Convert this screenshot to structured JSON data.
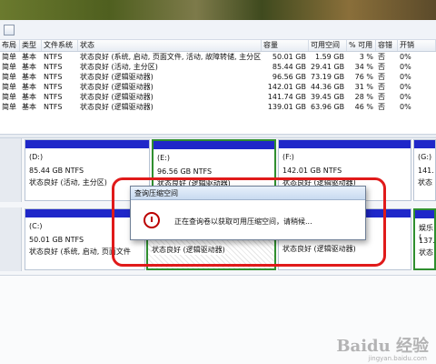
{
  "columns": [
    "布局",
    "类型",
    "文件系统",
    "状态",
    "容量",
    "可用空间",
    "% 可用",
    "容错",
    "开销"
  ],
  "volumes": [
    {
      "layout": "简单",
      "type": "基本",
      "fs": "NTFS",
      "status": "状态良好 (系统, 启动, 页面文件, 活动, 故障转储, 主分区)",
      "capacity": "50.01 GB",
      "free": "1.59 GB",
      "pct": "3 %",
      "fault": "否",
      "overhead": "0%"
    },
    {
      "layout": "简单",
      "type": "基本",
      "fs": "NTFS",
      "status": "状态良好 (活动, 主分区)",
      "capacity": "85.44 GB",
      "free": "29.41 GB",
      "pct": "34 %",
      "fault": "否",
      "overhead": "0%"
    },
    {
      "layout": "简单",
      "type": "基本",
      "fs": "NTFS",
      "status": "状态良好 (逻辑驱动器)",
      "capacity": "96.56 GB",
      "free": "73.19 GB",
      "pct": "76 %",
      "fault": "否",
      "overhead": "0%"
    },
    {
      "layout": "简单",
      "type": "基本",
      "fs": "NTFS",
      "status": "状态良好 (逻辑驱动器)",
      "capacity": "142.01 GB",
      "free": "44.36 GB",
      "pct": "31 %",
      "fault": "否",
      "overhead": "0%"
    },
    {
      "layout": "简单",
      "type": "基本",
      "fs": "NTFS",
      "status": "状态良好 (逻辑驱动器)",
      "capacity": "141.74 GB",
      "free": "39.45 GB",
      "pct": "28 %",
      "fault": "否",
      "overhead": "0%"
    },
    {
      "layout": "简单",
      "type": "基本",
      "fs": "NTFS",
      "status": "状态良好 (逻辑驱动器)",
      "capacity": "139.01 GB",
      "free": "63.96 GB",
      "pct": "46 %",
      "fault": "否",
      "overhead": "0%"
    }
  ],
  "disk0": {
    "d": {
      "name": "(D:)",
      "size": "85.44 GB NTFS",
      "status": "状态良好 (活动, 主分区)"
    },
    "e": {
      "name": "(E:)",
      "size": "96.56 GB NTFS",
      "status": "状态良好 (逻辑驱动器)"
    },
    "f": {
      "name": "(F:)",
      "size": "142.01 GB NTFS",
      "status": "状态良好 (逻辑驱动器)"
    },
    "g": {
      "name": "(G:)",
      "size": "141.",
      "status": "状态"
    }
  },
  "disk1": {
    "c": {
      "name": "(C:)",
      "size": "50.01 GB NTFS",
      "status": "状态良好 (系统, 启动, 页面文件"
    },
    "e_status": "状态良好 (逻辑驱动器)",
    "f_status": "状态良好 (逻辑驱动器)",
    "h": {
      "name": "娱乐 (",
      "size": "137.7",
      "status": "状态"
    }
  },
  "dialog": {
    "title": "查询压缩空间",
    "message": "正在查询卷以获取可用压缩空间，请稍候...",
    "icon": "clock-icon"
  },
  "watermark": {
    "brand": "Baidu 经验",
    "url": "jingyan.baidu.com"
  },
  "colors": {
    "partition_bar": "#1f27c9",
    "selected_border": "#2f8f2f",
    "callout": "#e01a1a"
  }
}
